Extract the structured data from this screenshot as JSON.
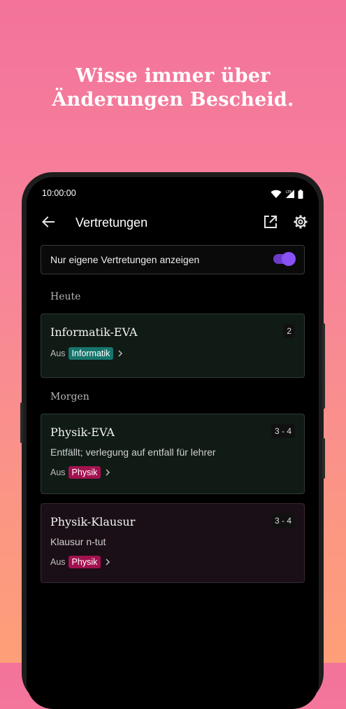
{
  "headline": {
    "line1": "Wisse immer über",
    "line2": "Änderungen Bescheid."
  },
  "status_bar": {
    "time": "10:00:00",
    "icons": [
      "wifi-icon",
      "signal-lte-icon",
      "battery-icon"
    ]
  },
  "app_bar": {
    "title": "Vertretungen",
    "icons": [
      "back-arrow-icon",
      "open-external-icon",
      "settings-gear-icon"
    ]
  },
  "filter": {
    "label": "Nur eigene Vertretungen anzeigen",
    "enabled": true
  },
  "sections": [
    {
      "label": "Heute",
      "cards": [
        {
          "title": "Informatik-EVA",
          "periods": "2",
          "description": "",
          "from_label": "Aus",
          "course": "Informatik",
          "course_color": "#16756c"
        }
      ]
    },
    {
      "label": "Morgen",
      "cards": [
        {
          "title": "Physik-EVA",
          "periods": "3 - 4",
          "description": "Entfällt; verlegung auf entfall für lehrer",
          "from_label": "Aus",
          "course": "Physik",
          "course_color": "#a3124f"
        },
        {
          "title": "Physik-Klausur",
          "periods": "3 - 4",
          "description": "Klausur n-tut",
          "from_label": "Aus",
          "course": "Physik",
          "course_color": "#a3124f"
        }
      ]
    }
  ],
  "colors": {
    "accent": "#8a52f5",
    "background_top": "#f3739b",
    "background_bottom": "#fd9f78"
  }
}
